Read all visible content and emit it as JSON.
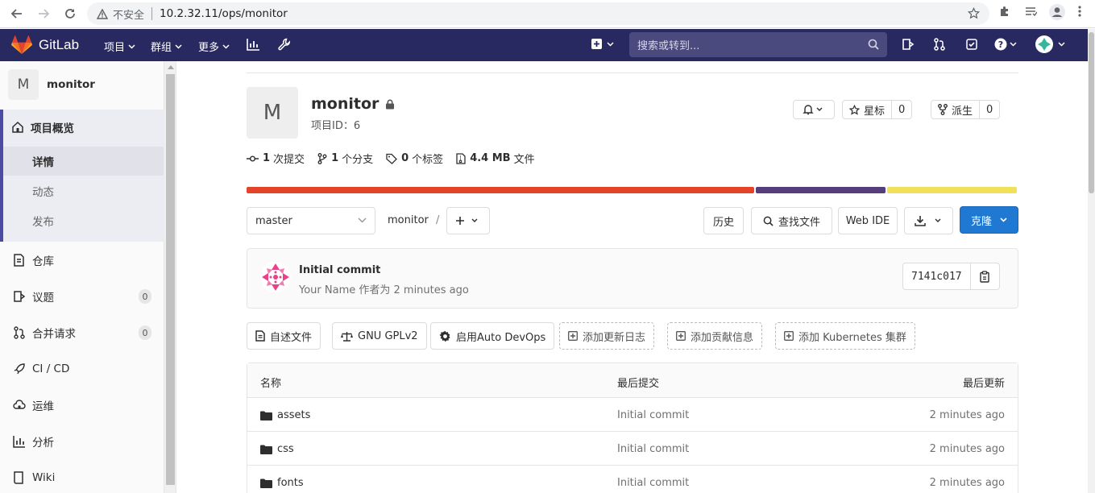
{
  "browser": {
    "insecure_label": "不安全",
    "url": "10.2.32.11/ops/monitor"
  },
  "header": {
    "brand": "GitLab",
    "nav": [
      "项目",
      "群组",
      "更多"
    ],
    "search_placeholder": "搜索或转到..."
  },
  "sidebar": {
    "project_initial": "M",
    "project_name": "monitor",
    "overview_label": "项目概览",
    "sub_items": [
      "详情",
      "动态",
      "发布"
    ],
    "items": [
      {
        "label": "仓库",
        "icon": "repository-icon"
      },
      {
        "label": "议题",
        "icon": "issues-icon",
        "badge": "0"
      },
      {
        "label": "合并请求",
        "icon": "merge-request-icon",
        "badge": "0"
      },
      {
        "label": "CI / CD",
        "icon": "rocket-icon"
      },
      {
        "label": "运维",
        "icon": "cloud-gear-icon"
      },
      {
        "label": "分析",
        "icon": "chart-icon"
      },
      {
        "label": "Wiki",
        "icon": "book-icon"
      }
    ]
  },
  "project": {
    "initial": "M",
    "name": "monitor",
    "id_label": "项目ID：6",
    "star_label": "星标",
    "star_count": "0",
    "fork_label": "派生",
    "fork_count": "0",
    "stats": {
      "commits_num": "1",
      "commits_label": "次提交",
      "branches_num": "1",
      "branches_label": "个分支",
      "tags_num": "0",
      "tags_label": "个标签",
      "size_num": "4.4 MB",
      "size_label": "文件"
    },
    "language_colors": [
      "#e24329",
      "#563d7c",
      "#f1e05a"
    ],
    "language_fractions": [
      0.66,
      0.17,
      0.17
    ]
  },
  "toolbar": {
    "branch": "master",
    "path": "monitor",
    "path_sep": "/",
    "history": "历史",
    "find_file": "查找文件",
    "web_ide": "Web IDE",
    "clone": "克隆"
  },
  "commit": {
    "title": "Initial commit",
    "meta": "Your Name 作者为 2 minutes ago",
    "sha": "7141c017"
  },
  "quick_actions": [
    {
      "label": "自述文件",
      "icon": "file-icon",
      "dashed": false
    },
    {
      "label": "GNU GPLv2",
      "icon": "scale-icon",
      "dashed": false
    },
    {
      "label": "启用Auto DevOps",
      "icon": "gear-icon",
      "dashed": false
    },
    {
      "label": "添加更新日志",
      "icon": "plus-square-icon",
      "dashed": true
    },
    {
      "label": "添加贡献信息",
      "icon": "plus-square-icon",
      "dashed": true
    },
    {
      "label": "添加 Kubernetes 集群",
      "icon": "plus-square-icon",
      "dashed": true
    }
  ],
  "file_tree": {
    "headers": [
      "名称",
      "最后提交",
      "最后更新"
    ],
    "rows": [
      {
        "name": "assets",
        "commit": "Initial commit",
        "updated": "2 minutes ago"
      },
      {
        "name": "css",
        "commit": "Initial commit",
        "updated": "2 minutes ago"
      },
      {
        "name": "fonts",
        "commit": "Initial commit",
        "updated": "2 minutes ago"
      }
    ]
  }
}
